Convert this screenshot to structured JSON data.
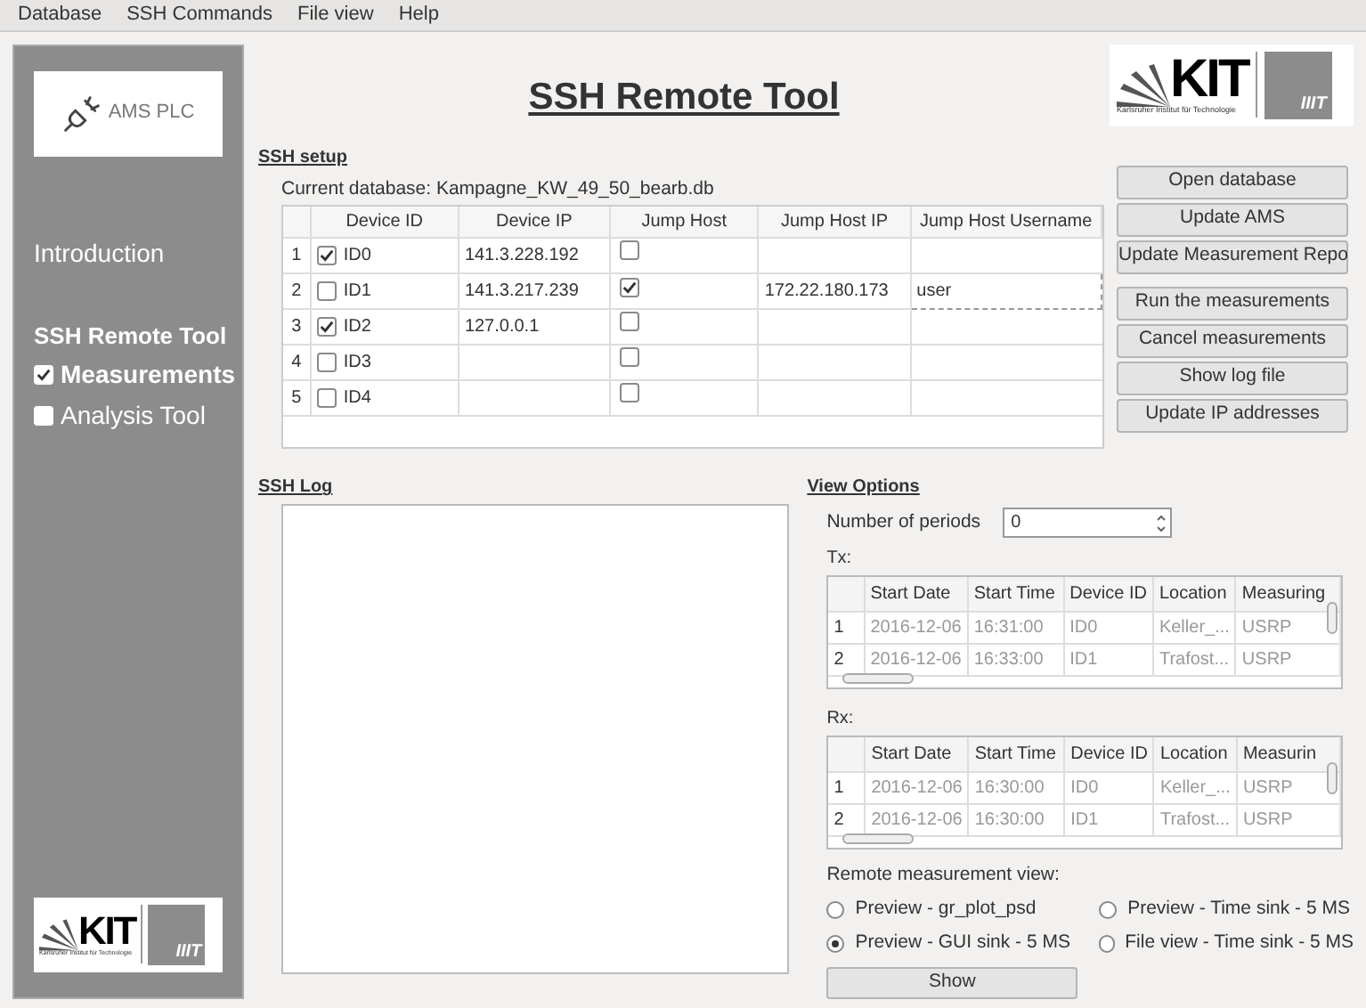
{
  "menu": [
    "Database",
    "SSH Commands",
    "File view",
    "Help"
  ],
  "sidebar": {
    "logo_text": "AMS PLC",
    "items": [
      {
        "label": "Introduction"
      },
      {
        "label": "SSH Remote Tool",
        "children": [
          {
            "label": "Measurements",
            "checked": true
          },
          {
            "label": "Analysis Tool",
            "checked": false
          }
        ]
      }
    ],
    "footer_logo": {
      "mark": "KIT",
      "caption": "Karlsruher Institut für Technologie",
      "badge": "IIIT"
    }
  },
  "header": {
    "title": "SSH Remote Tool",
    "logo": {
      "mark": "KIT",
      "caption": "Karlsruher Institut für Technologie",
      "badge": "IIIT"
    }
  },
  "ssh_setup": {
    "heading": "SSH setup",
    "database_label": "Current database: Kampagne_KW_49_50_bearb.db",
    "columns": [
      "Device ID",
      "Device IP",
      "Jump Host",
      "Jump Host IP",
      "Jump Host Username"
    ],
    "rows": [
      {
        "index": "1",
        "checked": true,
        "device_id": "ID0",
        "device_ip": "141.3.228.192",
        "jump_host": false,
        "focused": false
      },
      {
        "index": "2",
        "checked": false,
        "device_id": "ID1",
        "device_ip": "141.3.217.239",
        "jump_host": true,
        "jump_host_ip": "172.22.180.173",
        "username": "user",
        "focused": true
      },
      {
        "index": "3",
        "checked": true,
        "device_id": "ID2",
        "device_ip": "127.0.0.1",
        "jump_host": false,
        "focused": false
      },
      {
        "index": "4",
        "checked": false,
        "device_id": "ID3",
        "jump_host": false,
        "focused": false
      },
      {
        "index": "5",
        "checked": false,
        "device_id": "ID4",
        "jump_host": false,
        "focused": false
      }
    ]
  },
  "actions": [
    {
      "label": "Open database"
    },
    {
      "label": "Update AMS"
    },
    {
      "label": "Update Measurement Repo"
    },
    {
      "label": "Run the measurements"
    },
    {
      "label": "Cancel measurements"
    },
    {
      "label": "Show log file"
    },
    {
      "label": "Update IP addresses"
    }
  ],
  "ssh_log": {
    "heading": "SSH Log"
  },
  "view_options": {
    "heading": "View Options",
    "periods": {
      "label": "Number of periods",
      "value": "0"
    },
    "tables": [
      {
        "label": "Tx:",
        "columns": [
          "Start Date",
          "Start Time",
          "Device ID",
          "Location",
          "Measuring"
        ],
        "rows": [
          {
            "index": "1",
            "cells": [
              "2016-12-06",
              "16:31:00",
              "ID0",
              "Keller_...",
              "USRP"
            ]
          },
          {
            "index": "2",
            "cells": [
              "2016-12-06",
              "16:33:00",
              "ID1",
              "Trafost...",
              "USRP"
            ]
          }
        ]
      },
      {
        "label": "Rx:",
        "columns": [
          "Start Date",
          "Start Time",
          "Device ID",
          "Location",
          "Measurin"
        ],
        "rows": [
          {
            "index": "1",
            "cells": [
              "2016-12-06",
              "16:30:00",
              "ID0",
              "Keller_...",
              "USRP"
            ]
          },
          {
            "index": "2",
            "cells": [
              "2016-12-06",
              "16:30:00",
              "ID1",
              "Trafost...",
              "USRP"
            ]
          }
        ]
      }
    ],
    "remote_view": {
      "label": "Remote measurement view:",
      "options": [
        {
          "label": "Preview - gr_plot_psd",
          "selected": false
        },
        {
          "label": "Preview - Time sink - 5 MS",
          "selected": false
        },
        {
          "label": "Preview - GUI sink - 5 MS",
          "selected": true
        },
        {
          "label": "File view - Time sink - 5 MS",
          "selected": false
        }
      ]
    },
    "show_button": "Show"
  }
}
